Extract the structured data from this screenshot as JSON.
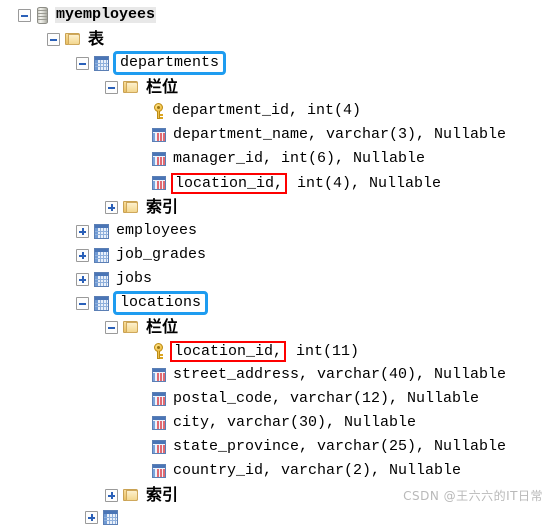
{
  "app": {
    "kind": "database-object-tree",
    "watermark": "CSDN @王六六的IT日常",
    "colors": {
      "highlight_blue": "#1e9cf0",
      "highlight_red": "#fe0000",
      "selection_gray": "#e8e8e8",
      "table_icon_blue": "#4a75b6",
      "key_icon_gold": "#e8b12c",
      "folder_icon_yellow": "#e8bf63"
    }
  },
  "tree": {
    "nodes": [
      {
        "id": "db-root",
        "depth": 0,
        "label": "myemployees",
        "icon": "database-icon",
        "expander": "minus",
        "selected": true
      },
      {
        "id": "folder-tables",
        "depth": 1,
        "label": "表",
        "icon": "folder-icon",
        "expander": "minus",
        "cjk": true
      },
      {
        "id": "tbl-departments",
        "depth": 2,
        "label": "departments",
        "icon": "table-icon",
        "expander": "minus",
        "box": "blue"
      },
      {
        "id": "dep-fields",
        "depth": 3,
        "label": "栏位",
        "icon": "folder-icon",
        "expander": "minus",
        "cjk": true
      },
      {
        "id": "dep-col-1",
        "depth": 4,
        "label": "department_id,  int(4)",
        "icon": "key-icon",
        "expander": "none"
      },
      {
        "id": "dep-col-2",
        "depth": 4,
        "label": "department_name,  varchar(3),  Nullable",
        "icon": "column-icon",
        "expander": "none"
      },
      {
        "id": "dep-col-3",
        "depth": 4,
        "label": "manager_id,  int(6),  Nullable",
        "icon": "column-icon",
        "expander": "none"
      },
      {
        "id": "dep-col-4",
        "depth": 4,
        "label": "location_id,",
        "suffix": "  int(4),  Nullable",
        "icon": "column-icon",
        "expander": "none",
        "box": "red"
      },
      {
        "id": "dep-indexes",
        "depth": 3,
        "label": "索引",
        "icon": "folder-icon",
        "expander": "plus",
        "cjk": true
      },
      {
        "id": "tbl-employees",
        "depth": 2,
        "label": "employees",
        "icon": "table-icon",
        "expander": "plus"
      },
      {
        "id": "tbl-job-grades",
        "depth": 2,
        "label": "job_grades",
        "icon": "table-icon",
        "expander": "plus"
      },
      {
        "id": "tbl-jobs",
        "depth": 2,
        "label": "jobs",
        "icon": "table-icon",
        "expander": "plus"
      },
      {
        "id": "tbl-locations",
        "depth": 2,
        "label": "locations",
        "icon": "table-icon",
        "expander": "minus",
        "box": "blue"
      },
      {
        "id": "loc-fields",
        "depth": 3,
        "label": "栏位",
        "icon": "folder-icon",
        "expander": "minus",
        "cjk": true
      },
      {
        "id": "loc-col-1",
        "depth": 4,
        "label": "location_id,",
        "suffix": "  int(11)",
        "icon": "key-icon",
        "expander": "none",
        "box": "red"
      },
      {
        "id": "loc-col-2",
        "depth": 4,
        "label": "street_address,  varchar(40),  Nullable",
        "icon": "column-icon",
        "expander": "none"
      },
      {
        "id": "loc-col-3",
        "depth": 4,
        "label": "postal_code,  varchar(12),  Nullable",
        "icon": "column-icon",
        "expander": "none"
      },
      {
        "id": "loc-col-4",
        "depth": 4,
        "label": "city,  varchar(30),  Nullable",
        "icon": "column-icon",
        "expander": "none"
      },
      {
        "id": "loc-col-5",
        "depth": 4,
        "label": "state_province,  varchar(25),  Nullable",
        "icon": "column-icon",
        "expander": "none"
      },
      {
        "id": "loc-col-6",
        "depth": 4,
        "label": "country_id,  varchar(2),  Nullable",
        "icon": "column-icon",
        "expander": "none"
      },
      {
        "id": "loc-indexes",
        "depth": 3,
        "label": "索引",
        "icon": "folder-icon",
        "expander": "plus",
        "cjk": true
      }
    ]
  }
}
